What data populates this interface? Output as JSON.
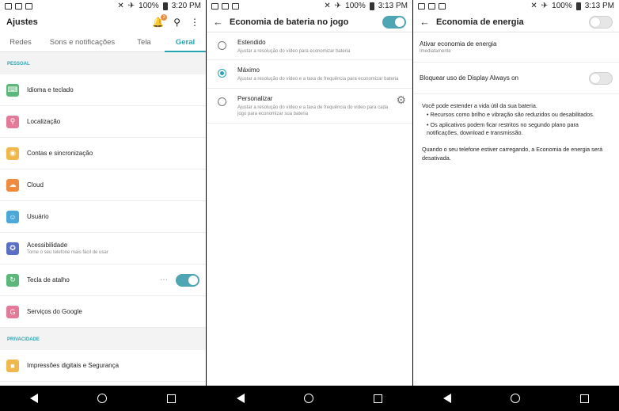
{
  "screen1": {
    "status": {
      "battery": "100%",
      "time": "3:20 PM",
      "notif_badge": "3"
    },
    "title": "Ajustes",
    "tabs": [
      "Redes",
      "Sons e notificações",
      "Tela",
      "Geral"
    ],
    "section1": "PESSOAL",
    "items": [
      {
        "label": "Idioma e teclado",
        "sub": "",
        "color": "#5cb87a",
        "icon": "keyboard-icon"
      },
      {
        "label": "Localização",
        "sub": "",
        "color": "#e57a98",
        "icon": "location-icon"
      },
      {
        "label": "Contas e sincronização",
        "sub": "",
        "color": "#f0b84a",
        "icon": "account-icon"
      },
      {
        "label": "Cloud",
        "sub": "",
        "color": "#f08a3c",
        "icon": "cloud-icon"
      },
      {
        "label": "Usuário",
        "sub": "",
        "color": "#4aa9d8",
        "icon": "user-icon"
      },
      {
        "label": "Acessibilidade",
        "sub": "Torne o seu telefone mais fácil de usar",
        "color": "#5a6fc8",
        "icon": "accessibility-icon"
      },
      {
        "label": "Tecla de atalho",
        "sub": "",
        "color": "#5cb87a",
        "icon": "shortcut-icon"
      },
      {
        "label": "Serviços do Google",
        "sub": "",
        "color": "#e57a98",
        "icon": "google-icon"
      }
    ],
    "section2": "PRIVACIDADE",
    "privacy_item": {
      "label": "Impressões digitais e Segurança",
      "color": "#f0b84a",
      "icon": "lock-icon"
    }
  },
  "screen2": {
    "status": {
      "battery": "100%",
      "time": "3:13 PM"
    },
    "title": "Economia de bateria no jogo",
    "options": [
      {
        "label": "Estendido",
        "sub": "Ajustar a resolução do vídeo para economizar bateria"
      },
      {
        "label": "Máximo",
        "sub": "Ajustar a resolução do vídeo e a taxa de frequência para economizar bateria"
      },
      {
        "label": "Personalizar",
        "sub": "Ajustar a resolução do vídeo e a taxa de frequência do vídeo para cada jogo para economizar sua bateria"
      }
    ]
  },
  "screen3": {
    "status": {
      "battery": "100%",
      "time": "3:13 PM"
    },
    "title": "Economia de energia",
    "activate_label": "Ativar economia de energia",
    "activate_sub": "Imediatamente",
    "aod_label": "Bloquear uso de Display Always on",
    "info_intro": "Você pode estender a vida útil da sua bateria.",
    "info_b1": "• Recursos como brilho e vibração são reduzidos ou desabilitados.",
    "info_b2": "• Os aplicativos podem ficar restritos no segundo plano para notificações, download e transmissão.",
    "info_outro": "Quando o seu telefone estiver carregando, a Economia de energia será desativada."
  }
}
